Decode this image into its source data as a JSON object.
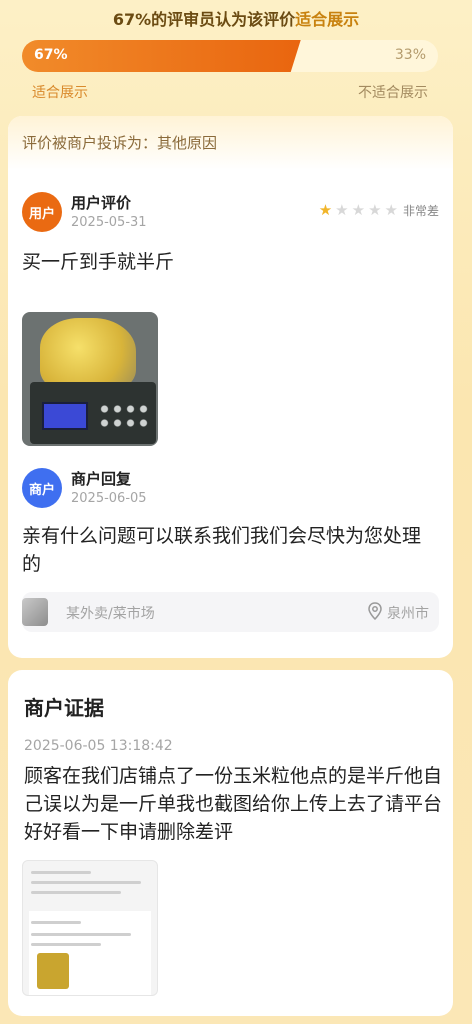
{
  "header": {
    "prefix": "67%的评审员认为该评价",
    "highlight": "适合展示"
  },
  "vote": {
    "suitable_percent": 67,
    "suitable_label_pct": "67%",
    "unsuitable_label_pct": "33%",
    "suitable_label": "适合展示",
    "unsuitable_label": "不适合展示",
    "colors": {
      "fill": "#e9650f",
      "track": "#fff6da"
    }
  },
  "complaint": {
    "text": "评价被商户投诉为：其他原因"
  },
  "user_review": {
    "avatar_text": "用户",
    "title": "用户评价",
    "date": "2025-05-31",
    "stars_total": 5,
    "stars_filled": 1,
    "rating_text": "非常差",
    "content": "买一斤到手就半斤",
    "photo_icon": "corn-on-scale-photo"
  },
  "merchant_reply": {
    "avatar_text": "商户",
    "title": "商户回复",
    "date": "2025-06-05",
    "content": "亲有什么问题可以联系我们我们会尽快为您处理的"
  },
  "location": {
    "shop": "某外卖/菜市场",
    "city": "泉州市",
    "icon": "location-pin-icon"
  },
  "evidence": {
    "title": "商户证据",
    "timestamp": "2025-06-05 13:18:42",
    "content": "顾客在我们店铺点了一份玉米粒他点的是半斤他自己误以为是一斤单我也截图给你上传上去了请平台好好看一下申请删除差评",
    "image_icon": "order-screenshot-thumbnail"
  }
}
